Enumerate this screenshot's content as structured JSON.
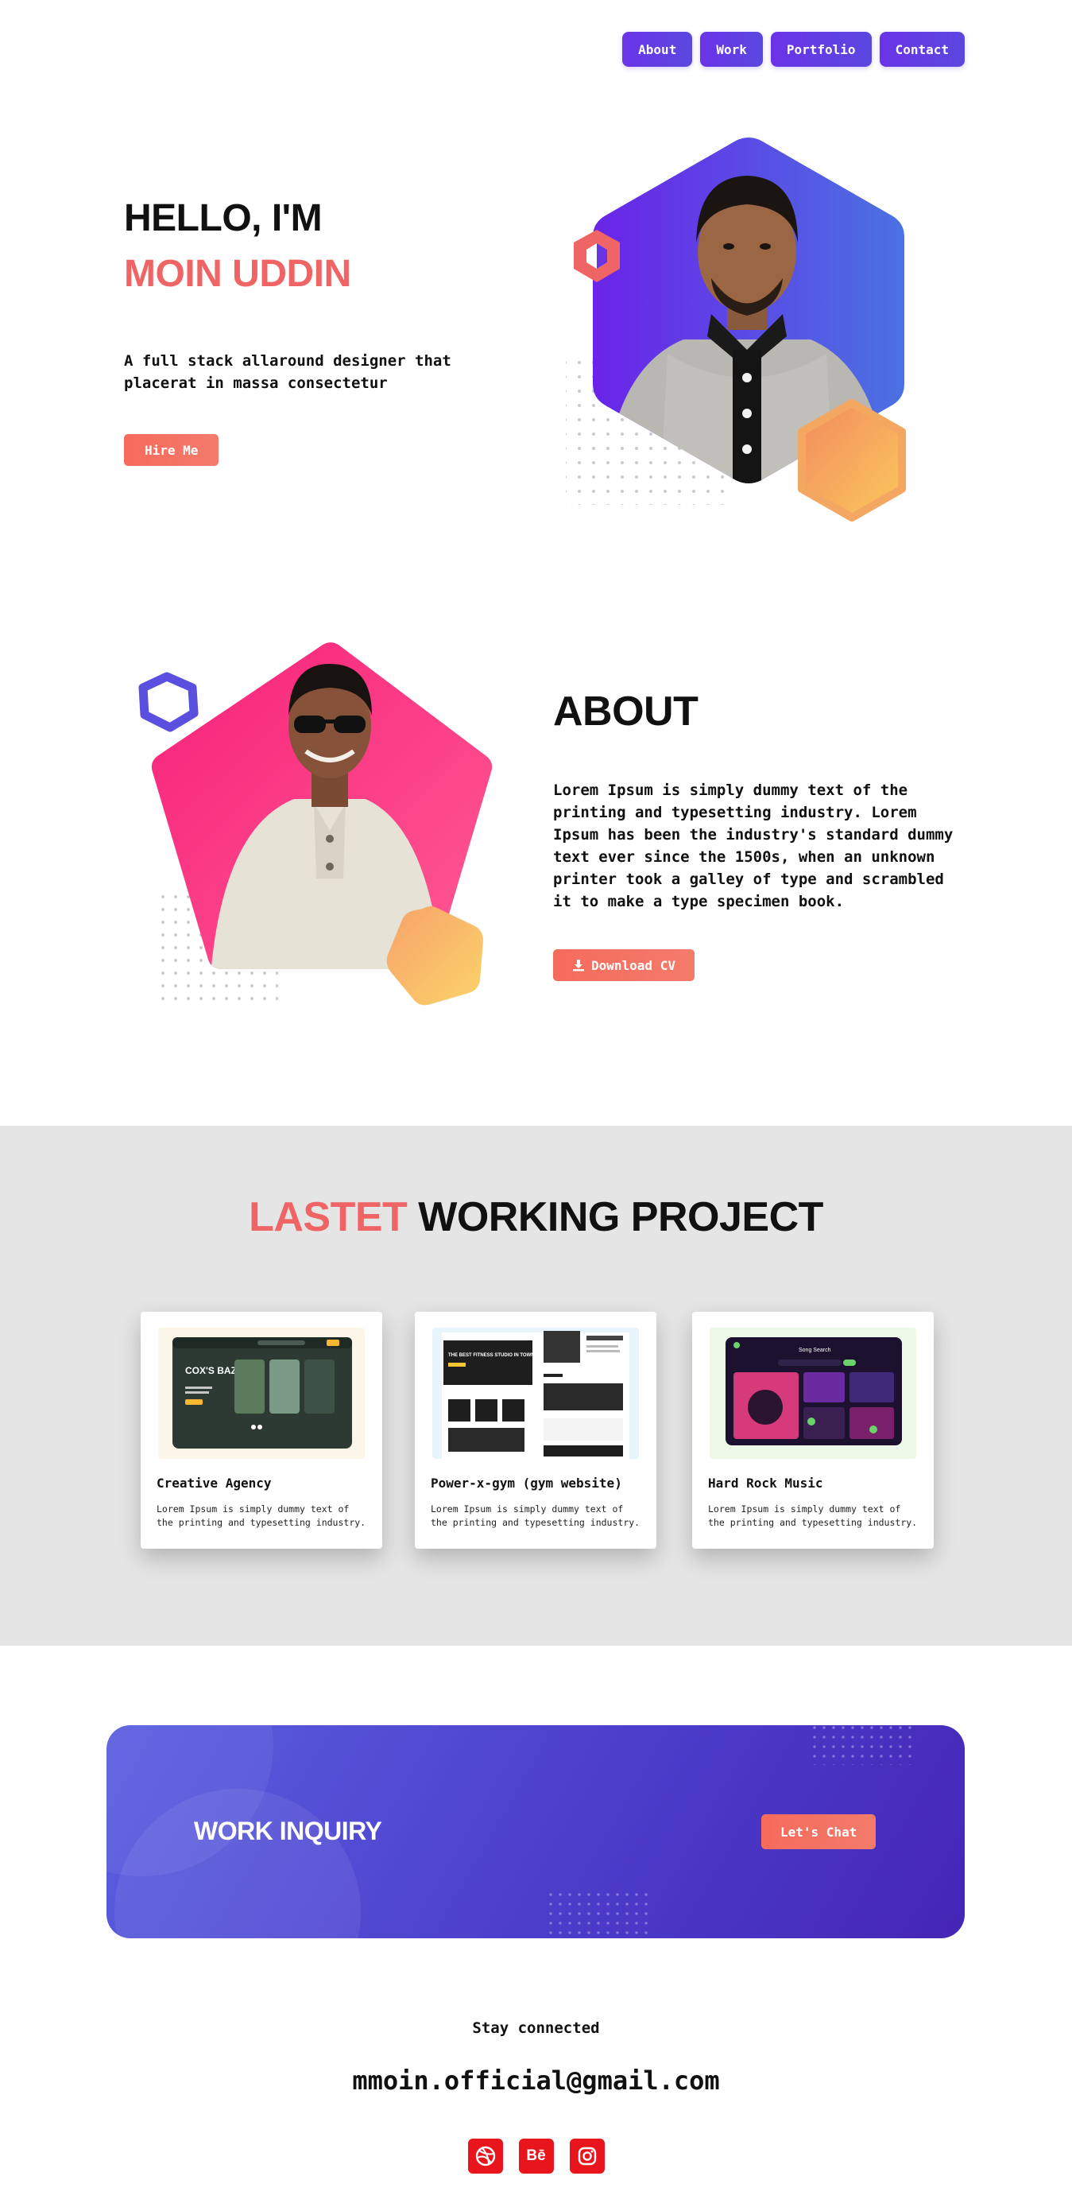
{
  "nav": {
    "items": [
      {
        "label": "About"
      },
      {
        "label": "Work"
      },
      {
        "label": "Portfolio"
      },
      {
        "label": "Contact"
      }
    ]
  },
  "hero": {
    "greeting": "HELLO, I'M",
    "name": "MOIN UDDIN",
    "tagline": "A full stack allaround designer that placerat in massa consectetur",
    "cta_label": "Hire Me"
  },
  "about": {
    "title": "ABOUT",
    "body": "Lorem Ipsum is simply dummy text of the printing and typesetting industry. Lorem Ipsum has been the industry's standard dummy text ever since the 1500s, when an unknown printer took a galley of type and scrambled it to make a type specimen book.",
    "cv_label": "Download CV",
    "cv_icon": "download-icon"
  },
  "projects": {
    "title_accent": "LASTET",
    "title_rest": "WORKING PROJECT",
    "items": [
      {
        "title": "Creative Agency",
        "description": "Lorem Ipsum is simply dummy text of the printing and typesetting industry.",
        "thumb_text": "COX'S BAZAR"
      },
      {
        "title": "Power-x-gym (gym website)",
        "description": "Lorem Ipsum is simply dummy text of the printing and typesetting industry.",
        "thumb_text": "THE BEST FITNESS STUDIO IN TOWN"
      },
      {
        "title": "Hard Rock Music",
        "description": "Lorem Ipsum is simply dummy text of the printing and typesetting industry.",
        "thumb_text": "Song Search"
      }
    ]
  },
  "inquiry": {
    "title": "WORK INQUIRY",
    "cta_label": "Let's Chat"
  },
  "footer": {
    "stay_connected": "Stay connected",
    "email": "mmoin.official@gmail.com",
    "socials": [
      {
        "name": "dribbble-icon"
      },
      {
        "name": "behance-icon",
        "label": "Bē"
      },
      {
        "name": "instagram-icon"
      }
    ]
  },
  "colors": {
    "accent": "#ef6464",
    "nav": "#5b3fe3",
    "inquiry": "#4b3bc9",
    "social": "#e8161c"
  }
}
